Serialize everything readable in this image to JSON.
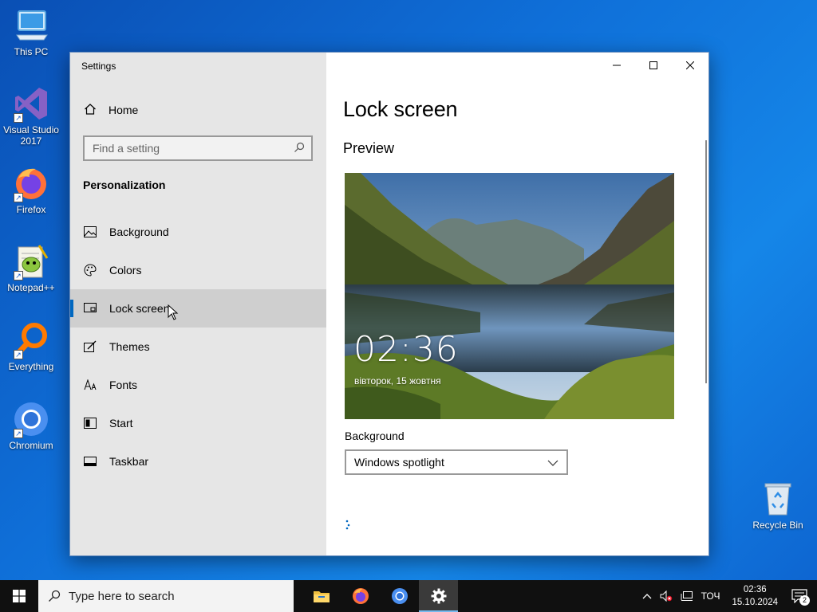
{
  "desktop": {
    "icons": [
      {
        "label": "This PC"
      },
      {
        "label": "Visual Studio 2017"
      },
      {
        "label": "Firefox"
      },
      {
        "label": "Notepad++"
      },
      {
        "label": "Everything"
      },
      {
        "label": "Chromium"
      },
      {
        "label": "Recycle Bin"
      }
    ]
  },
  "window": {
    "title": "Settings",
    "sidebar": {
      "home_label": "Home",
      "search_placeholder": "Find a setting",
      "section_title": "Personalization",
      "items": [
        {
          "label": "Background",
          "icon": "image-icon"
        },
        {
          "label": "Colors",
          "icon": "palette-icon"
        },
        {
          "label": "Lock screen",
          "icon": "lock-screen-icon",
          "selected": true
        },
        {
          "label": "Themes",
          "icon": "brush-icon"
        },
        {
          "label": "Fonts",
          "icon": "font-icon"
        },
        {
          "label": "Start",
          "icon": "start-icon"
        },
        {
          "label": "Taskbar",
          "icon": "taskbar-icon"
        }
      ]
    },
    "content": {
      "page_title": "Lock screen",
      "preview_heading": "Preview",
      "preview_time": "02:36",
      "preview_date": "вівторок, 15 жовтня",
      "background_label": "Background",
      "background_value": "Windows spotlight"
    }
  },
  "taskbar": {
    "search_text": "Type here to search",
    "input_indicator": "ТОЧ",
    "clock_time": "02:36",
    "clock_date": "15.10.2024",
    "notification_count": "2"
  },
  "colors": {
    "accent": "#0067c0",
    "desktop": "#0f6fd8",
    "taskbar": "#101010"
  }
}
